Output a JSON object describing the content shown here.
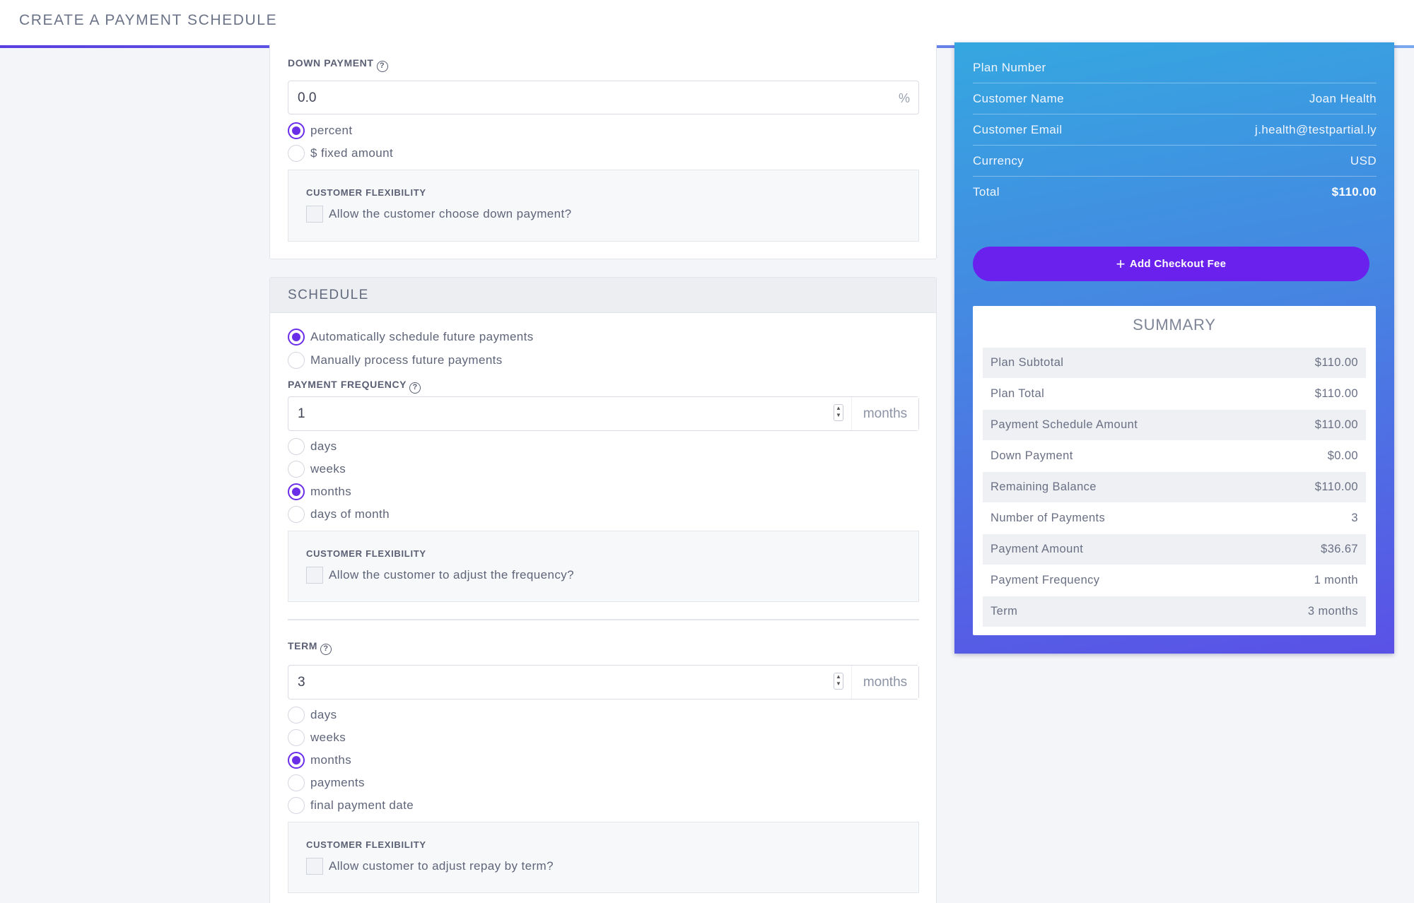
{
  "header": {
    "title": "CREATE A PAYMENT SCHEDULE"
  },
  "down_payment": {
    "label": "DOWN PAYMENT",
    "help_icon": "help-circle-icon",
    "value": "0.0",
    "suffix": "%",
    "options": [
      {
        "label": "percent",
        "selected": true
      },
      {
        "label": "$ fixed amount",
        "selected": false
      }
    ],
    "flexibility": {
      "label": "CUSTOMER FLEXIBILITY",
      "checkbox_label": "Allow the customer choose down payment?"
    }
  },
  "schedule": {
    "title": "SCHEDULE",
    "mode_options": [
      {
        "label": "Automatically schedule future payments",
        "selected": true
      },
      {
        "label": "Manually process future payments",
        "selected": false
      }
    ],
    "frequency": {
      "label": "PAYMENT FREQUENCY",
      "value": "1",
      "unit": "months",
      "options": [
        {
          "label": "days",
          "selected": false
        },
        {
          "label": "weeks",
          "selected": false
        },
        {
          "label": "months",
          "selected": true
        },
        {
          "label": "days of month",
          "selected": false
        }
      ],
      "flexibility": {
        "label": "CUSTOMER FLEXIBILITY",
        "checkbox_label": "Allow the customer to adjust the frequency?"
      }
    },
    "term": {
      "label": "TERM",
      "value": "3",
      "unit": "months",
      "options": [
        {
          "label": "days",
          "selected": false
        },
        {
          "label": "weeks",
          "selected": false
        },
        {
          "label": "months",
          "selected": true
        },
        {
          "label": "payments",
          "selected": false
        },
        {
          "label": "final payment date",
          "selected": false
        }
      ],
      "flexibility": {
        "label": "CUSTOMER FLEXIBILITY",
        "checkbox_label": "Allow customer to adjust repay by term?"
      }
    }
  },
  "plan_info": [
    {
      "key": "Plan Number",
      "value": ""
    },
    {
      "key": "Customer Name",
      "value": "Joan Health"
    },
    {
      "key": "Customer Email",
      "value": "j.health@testpartial.ly"
    },
    {
      "key": "Currency",
      "value": "USD"
    },
    {
      "key": "Total",
      "value": "$110.00"
    }
  ],
  "add_fee_button": {
    "label": "Add Checkout Fee",
    "icon": "plus-icon"
  },
  "summary": {
    "title": "SUMMARY",
    "rows": [
      {
        "key": "Plan Subtotal",
        "value": "$110.00"
      },
      {
        "key": "Plan Total",
        "value": "$110.00"
      },
      {
        "key": "Payment Schedule Amount",
        "value": "$110.00"
      },
      {
        "key": "Down Payment",
        "value": "$0.00"
      },
      {
        "key": "Remaining Balance",
        "value": "$110.00"
      },
      {
        "key": "Number of Payments",
        "value": "3"
      },
      {
        "key": "Payment Amount",
        "value": "$36.67"
      },
      {
        "key": "Payment Frequency",
        "value": "1 month"
      },
      {
        "key": "Term",
        "value": "3 months"
      }
    ]
  },
  "colors": {
    "accent": "#6a2ee8",
    "button": "#6a21ee",
    "panel_top": "#35a7e0",
    "panel_bottom": "#5a51e6"
  }
}
